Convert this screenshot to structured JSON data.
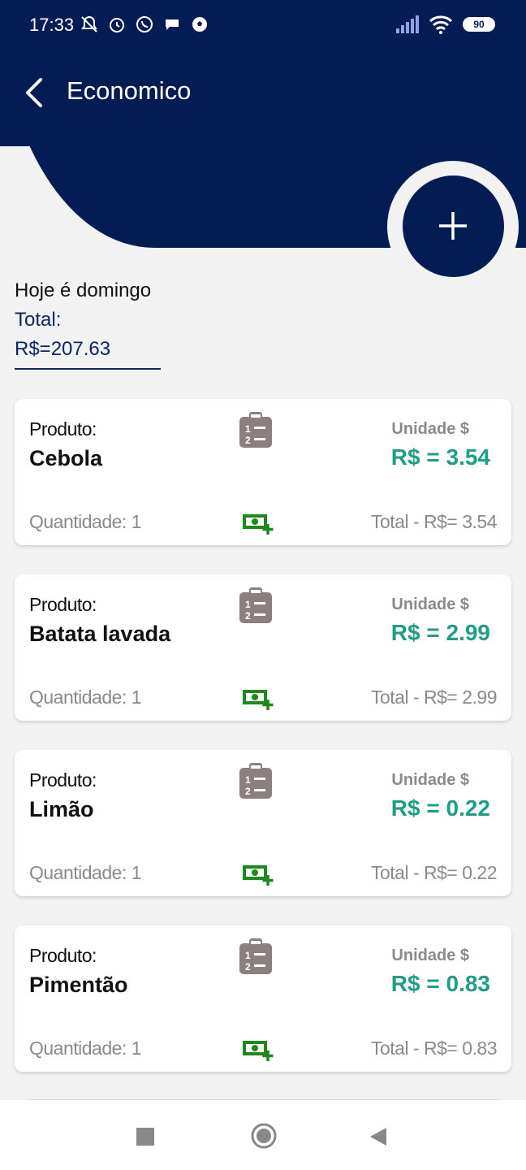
{
  "status_bar": {
    "time": "17:33",
    "battery": "90",
    "left_icons": [
      "muted-bell-icon",
      "alarm-icon",
      "whatsapp-icon",
      "chat-icon",
      "soccer-ball-icon"
    ],
    "right_icons": [
      "signal-icon",
      "wifi-icon",
      "battery-icon"
    ]
  },
  "header": {
    "title": "Economico",
    "back_icon": "chevron-left-icon",
    "background_color": "#041c54"
  },
  "fab": {
    "icon": "plus-icon"
  },
  "summary": {
    "day_text": "Hoje é domingo",
    "total_label": "Total:",
    "total_value": "R$=207.63"
  },
  "products": [
    {
      "label": "Produto:",
      "name": "Cebola",
      "unit_label": "Unidade $",
      "unit_price": "R$ = 3.54",
      "quantity": "Quantidade: 1",
      "total": "Total - R$= 3.54"
    },
    {
      "label": "Produto:",
      "name": "Batata lavada",
      "unit_label": "Unidade $",
      "unit_price": "R$ = 2.99",
      "quantity": "Quantidade: 1",
      "total": "Total - R$= 2.99"
    },
    {
      "label": "Produto:",
      "name": "Limão",
      "unit_label": "Unidade $",
      "unit_price": "R$ = 0.22",
      "quantity": "Quantidade: 1",
      "total": "Total - R$= 0.22"
    },
    {
      "label": "Produto:",
      "name": "Pimentão",
      "unit_label": "Unidade $",
      "unit_price": "R$ = 0.83",
      "quantity": "Quantidade: 1",
      "total": "Total - R$= 0.83"
    }
  ],
  "colors": {
    "primary": "#041c54",
    "price": "#1f9e86",
    "money_icon": "#1a8a1a",
    "list_icon": "#8c7f80"
  },
  "nav_bar": {
    "icons": [
      "recents-square-icon",
      "home-circle-icon",
      "back-triangle-icon"
    ]
  }
}
